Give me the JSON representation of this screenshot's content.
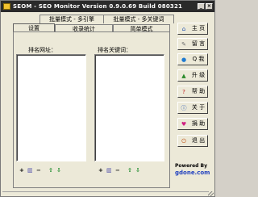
{
  "window": {
    "title": "SEOM - SEO Monitor Version 0.9.0.69 Build 080321"
  },
  "tabs_back": [
    {
      "label": "批量模式 - 多引擎"
    },
    {
      "label": "批量模式 - 多关键词"
    }
  ],
  "tabs_front": [
    {
      "label": "设置"
    },
    {
      "label": "收录统计"
    },
    {
      "label": "简单模式"
    }
  ],
  "main": {
    "url_column_label": "排名网址：",
    "keyword_column_label": "排名关键词：",
    "url_tools": [
      "+",
      "▥",
      "−",
      "⇧",
      "⇩"
    ],
    "keyword_tools": [
      "+",
      "▥",
      "−",
      "⇧",
      "⇩"
    ]
  },
  "sidebar": {
    "buttons": [
      {
        "label": "主 页",
        "icon": "home-icon"
      },
      {
        "label": "留 言",
        "icon": "message-icon"
      },
      {
        "label": "Q 我",
        "icon": "qq-icon"
      },
      {
        "label": "升 级",
        "icon": "upgrade-icon"
      },
      {
        "label": "帮 助",
        "icon": "help-icon"
      },
      {
        "label": "关 于",
        "icon": "info-icon"
      },
      {
        "label": "捐 助",
        "icon": "donate-icon"
      },
      {
        "label": "退 出",
        "icon": "exit-icon"
      }
    ]
  },
  "footer": {
    "powered_by": "Powered By",
    "site": "gdone.com"
  },
  "colors": {
    "titlebar": "#2a2a2a",
    "face": "#ece9d8",
    "link": "#1f3fbf"
  }
}
